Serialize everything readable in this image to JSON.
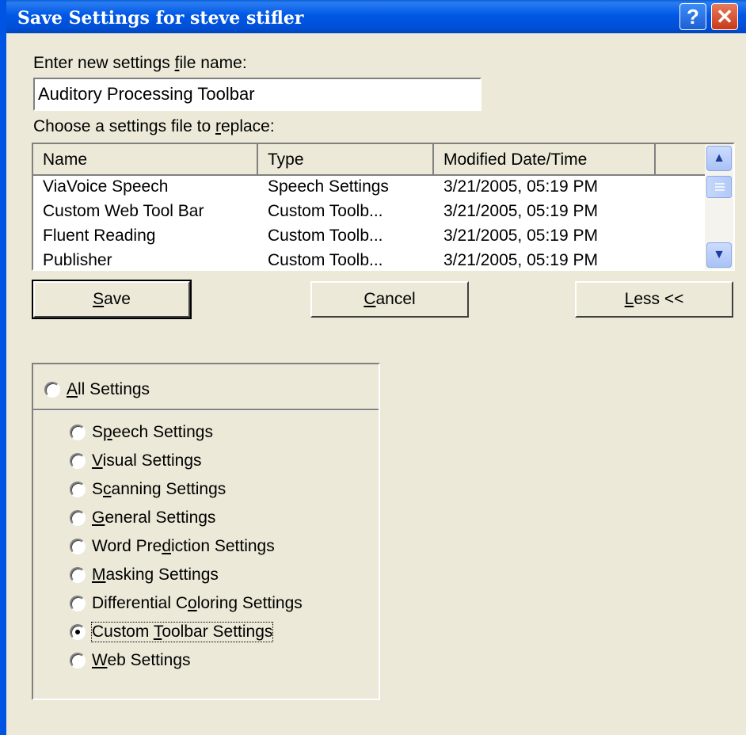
{
  "window": {
    "title": "Save Settings for steve stifler"
  },
  "titlebar": {
    "help_glyph": "?",
    "close_glyph": "✕"
  },
  "form": {
    "filename_label_pre": "Enter new settings ",
    "filename_label_hot": "f",
    "filename_label_post": "ile name:",
    "filename_value": "Auditory Processing Toolbar",
    "replace_label_pre": "Choose a settings file to ",
    "replace_label_hot": "r",
    "replace_label_post": "eplace:"
  },
  "list": {
    "columns": [
      "Name",
      "Type",
      "Modified Date/Time"
    ],
    "rows": [
      [
        "ViaVoice Speech",
        "Speech Settings",
        "3/21/2005, 05:19 PM"
      ],
      [
        "Custom Web Tool Bar",
        "Custom Toolb...",
        "3/21/2005, 05:19 PM"
      ],
      [
        "Fluent Reading",
        "Custom Toolb...",
        "3/21/2005, 05:19 PM"
      ],
      [
        "Publisher",
        "Custom Toolb...",
        "3/21/2005, 05:19 PM"
      ]
    ]
  },
  "buttons": {
    "save_hot": "S",
    "save_rest": "ave",
    "cancel_hot": "C",
    "cancel_rest": "ancel",
    "less_hot": "L",
    "less_rest": "ess <<"
  },
  "options": {
    "all": {
      "hot": "A",
      "rest": "ll Settings",
      "selected": false
    },
    "items": [
      {
        "pre": "S",
        "hot": "p",
        "post": "eech Settings",
        "selected": false
      },
      {
        "pre": "",
        "hot": "V",
        "post": "isual Settings",
        "selected": false
      },
      {
        "pre": "S",
        "hot": "c",
        "post": "anning Settings",
        "selected": false
      },
      {
        "pre": "",
        "hot": "G",
        "post": "eneral Settings",
        "selected": false
      },
      {
        "pre": "Word Pre",
        "hot": "d",
        "post": "iction Settings",
        "selected": false
      },
      {
        "pre": "",
        "hot": "M",
        "post": "asking Settings",
        "selected": false
      },
      {
        "pre": "Differential C",
        "hot": "o",
        "post": "loring Settings",
        "selected": false
      },
      {
        "pre": "Custom ",
        "hot": "T",
        "post": "oolbar Settings",
        "selected": true
      },
      {
        "pre": "",
        "hot": "W",
        "post": "eb Settings",
        "selected": false
      }
    ]
  },
  "colors": {
    "titlebar": "#0058e6",
    "dialog_bg": "#ece9d8",
    "close_button": "#c8391a"
  }
}
